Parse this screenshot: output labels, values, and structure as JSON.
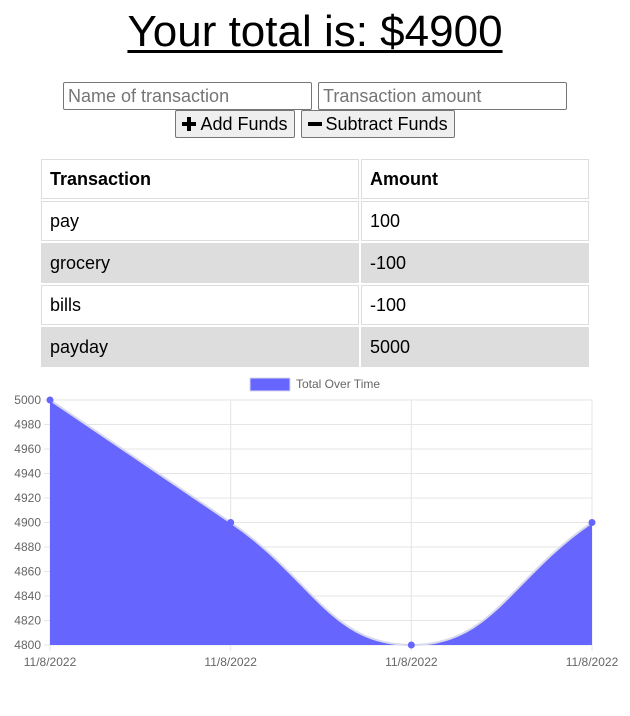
{
  "header": {
    "total_text": "Your total is: $4900"
  },
  "form": {
    "name_placeholder": "Name of transaction",
    "amount_placeholder": "Transaction amount",
    "add_label": "Add Funds",
    "subtract_label": "Subtract Funds"
  },
  "table": {
    "headers": [
      "Transaction",
      "Amount"
    ],
    "rows": [
      {
        "name": "pay",
        "amount": "100"
      },
      {
        "name": "grocery",
        "amount": "-100"
      },
      {
        "name": "bills",
        "amount": "-100"
      },
      {
        "name": "payday",
        "amount": "5000"
      }
    ]
  },
  "chart_data": {
    "type": "area",
    "categories": [
      "11/8/2022",
      "11/8/2022",
      "11/8/2022",
      "11/8/2022"
    ],
    "series": [
      {
        "name": "Total Over Time",
        "values": [
          5000,
          4900,
          4800,
          4900
        ],
        "color": "#6666ff"
      }
    ],
    "ylim": [
      4800,
      5000
    ],
    "yticks": [
      5000,
      4980,
      4960,
      4940,
      4920,
      4900,
      4880,
      4860,
      4840,
      4820,
      4800
    ],
    "grid": true,
    "legend": "top"
  },
  "colors": {
    "area_fill": "#6666ff",
    "area_line": "#d8d8ee",
    "grid": "#e5e5e5",
    "tick_text": "#666666"
  }
}
